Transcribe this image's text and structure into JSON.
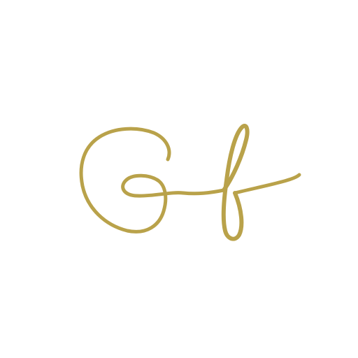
{
  "logo": {
    "monogram_text": "Gf",
    "icon": "gf-script-monogram-icon",
    "color": "#b9a24a",
    "background": "#ffffff"
  }
}
